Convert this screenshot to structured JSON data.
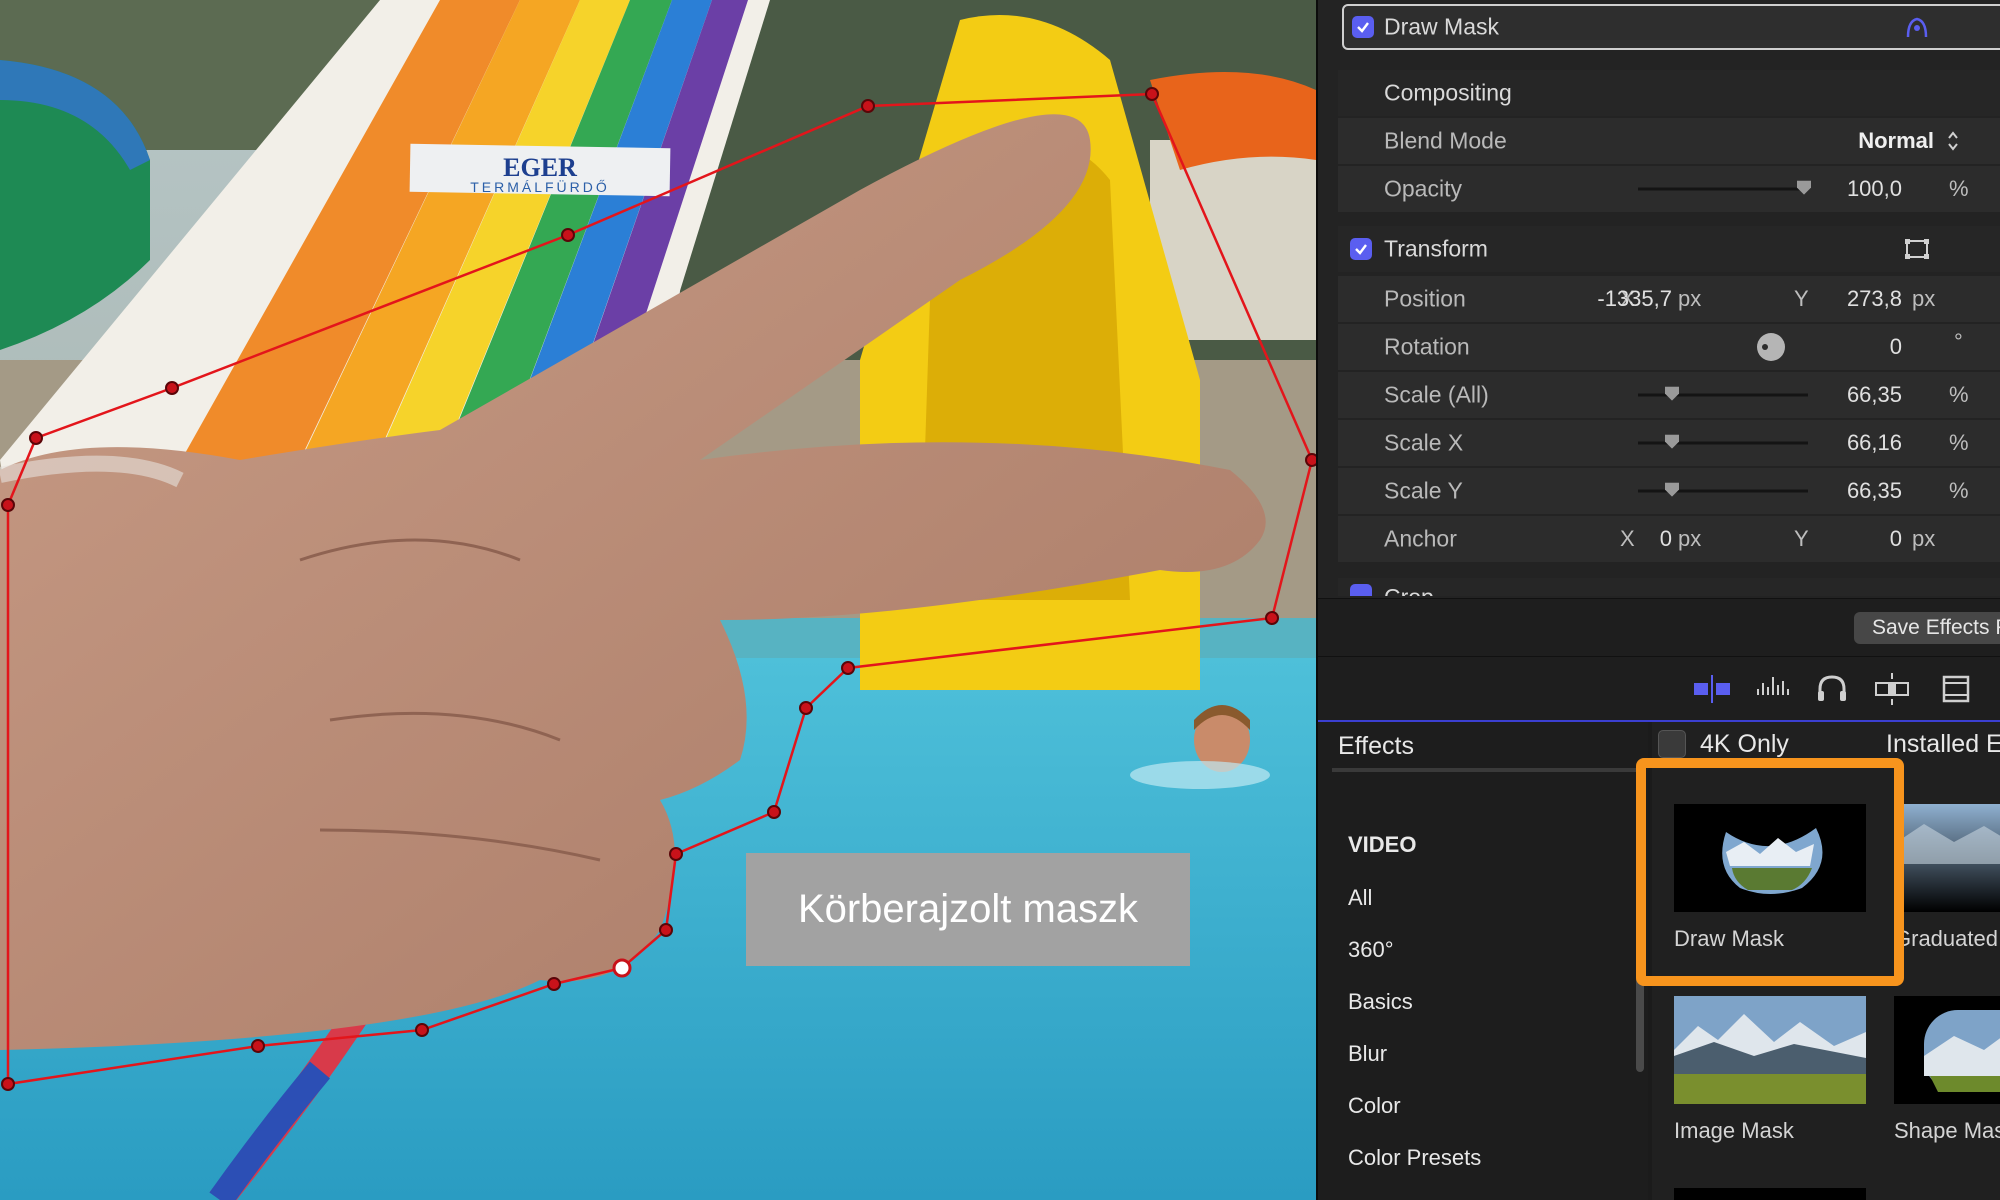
{
  "viewer": {
    "caption": "Körberajzolt maszk",
    "sign_line1": "EGER",
    "sign_line2": "TERMÁLFÜRDŐ"
  },
  "inspector": {
    "draw_mask": "Draw Mask",
    "compositing": "Compositing",
    "blend_mode_label": "Blend Mode",
    "blend_mode_value": "Normal",
    "opacity_label": "Opacity",
    "opacity_value": "100,0",
    "percent": "%",
    "transform": "Transform",
    "position_label": "Position",
    "axis_x": "X",
    "axis_y": "Y",
    "px": "px",
    "position_x": "-1335,7",
    "position_y": "273,8",
    "rotation_label": "Rotation",
    "rotation_value": "0",
    "degree": "°",
    "scale_all_label": "Scale (All)",
    "scale_all_value": "66,35",
    "scale_x_label": "Scale X",
    "scale_x_value": "66,16",
    "scale_y_label": "Scale Y",
    "scale_y_value": "66,35",
    "anchor_label": "Anchor",
    "anchor_x": "0",
    "anchor_y": "0",
    "crop": "Crop",
    "save_effects": "Save Effects Preset"
  },
  "toolbar": {
    "icons": [
      "video-inspector-icon",
      "audio-inspector-icon",
      "headphones-icon",
      "transition-icon",
      "film-icon"
    ]
  },
  "browser": {
    "title": "Effects",
    "only_4k": "4K Only",
    "installed": "Installed Effects",
    "categories": [
      "VIDEO",
      "All",
      "360°",
      "Basics",
      "Blur",
      "Color",
      "Color Presets"
    ],
    "items": [
      "Draw Mask",
      "Graduated Mask",
      "Image Mask",
      "Shape Mask"
    ]
  },
  "colors": {
    "accent": "#5a5ef0",
    "highlight": "#f7941d",
    "mask_line": "#e3151b"
  }
}
